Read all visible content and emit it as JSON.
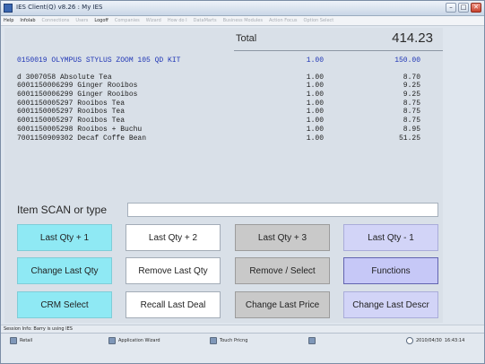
{
  "window": {
    "title": "IES Client(Q) v8.26 : My IES",
    "min_glyph": "–",
    "max_glyph": "□",
    "close_glyph": "✕"
  },
  "menu": [
    {
      "label": "Help",
      "enabled": true
    },
    {
      "label": "Infolab",
      "enabled": true
    },
    {
      "label": "Connections",
      "enabled": false
    },
    {
      "label": "Users",
      "enabled": false
    },
    {
      "label": "Logoff",
      "enabled": true
    },
    {
      "label": "Companies",
      "enabled": false
    },
    {
      "label": "Wizard",
      "enabled": false
    },
    {
      "label": "How do I",
      "enabled": false
    },
    {
      "label": "DataMarts",
      "enabled": false
    },
    {
      "label": "Business Modules",
      "enabled": false
    },
    {
      "label": "Action Focus",
      "enabled": false
    },
    {
      "label": "Option Select",
      "enabled": false
    }
  ],
  "total": {
    "label": "Total",
    "value": "414.23"
  },
  "lines": [
    {
      "desc": "0150019 OLYMPUS STYLUS ZOOM 105 QD KIT",
      "qty": "1.00",
      "amount": "150.00",
      "highlight": true
    },
    {
      "desc": "d 3007058 Absolute Tea",
      "qty": "1.00",
      "amount": "8.70",
      "highlight": false
    },
    {
      "desc": "6001150006299 Ginger Rooibos",
      "qty": "1.00",
      "amount": "9.25",
      "highlight": false
    },
    {
      "desc": "6001150006299 Ginger Rooibos",
      "qty": "1.00",
      "amount": "9.25",
      "highlight": false
    },
    {
      "desc": "6001150005297 Rooibos Tea",
      "qty": "1.00",
      "amount": "8.75",
      "highlight": false
    },
    {
      "desc": "6001150005297 Rooibos Tea",
      "qty": "1.00",
      "amount": "8.75",
      "highlight": false
    },
    {
      "desc": "6001150005297 Rooibos Tea",
      "qty": "1.00",
      "amount": "8.75",
      "highlight": false
    },
    {
      "desc": "6001150005298 Rooibos + Buchu",
      "qty": "1.00",
      "amount": "8.95",
      "highlight": false
    },
    {
      "desc": "7001150909302 Decaf Coffe Bean",
      "qty": "1.00",
      "amount": "51.25",
      "highlight": false
    }
  ],
  "scan": {
    "label": "Item SCAN or type",
    "value": ""
  },
  "buttons": {
    "last_qty_plus_1": "Last Qty + 1",
    "last_qty_plus_2": "Last Qty + 2",
    "last_qty_plus_3": "Last Qty + 3",
    "last_qty_minus_1": "Last Qty - 1",
    "change_last_qty": "Change Last Qty",
    "remove_last_qty": "Remove Last Qty",
    "remove_select": "Remove / Select",
    "functions": "Functions",
    "crm_select": "CRM Select",
    "recall_last_deal": "Recall Last Deal",
    "change_last_price": "Change Last Price",
    "change_last_descr": "Change Last Descr"
  },
  "session": "Session Info: Barry is using IES",
  "tasks": {
    "retail": "Retail",
    "app_wizard": "Application Wizard",
    "touch_pricing": "Touch Pricng",
    "date": "2010/04/30",
    "time": "16:43:14"
  },
  "colors": {
    "cyan_button": "#8fe9f4",
    "grey_button": "#c9c9c9",
    "lavender_button": "#d2d4f7",
    "highlight_line": "#1f35b5"
  }
}
